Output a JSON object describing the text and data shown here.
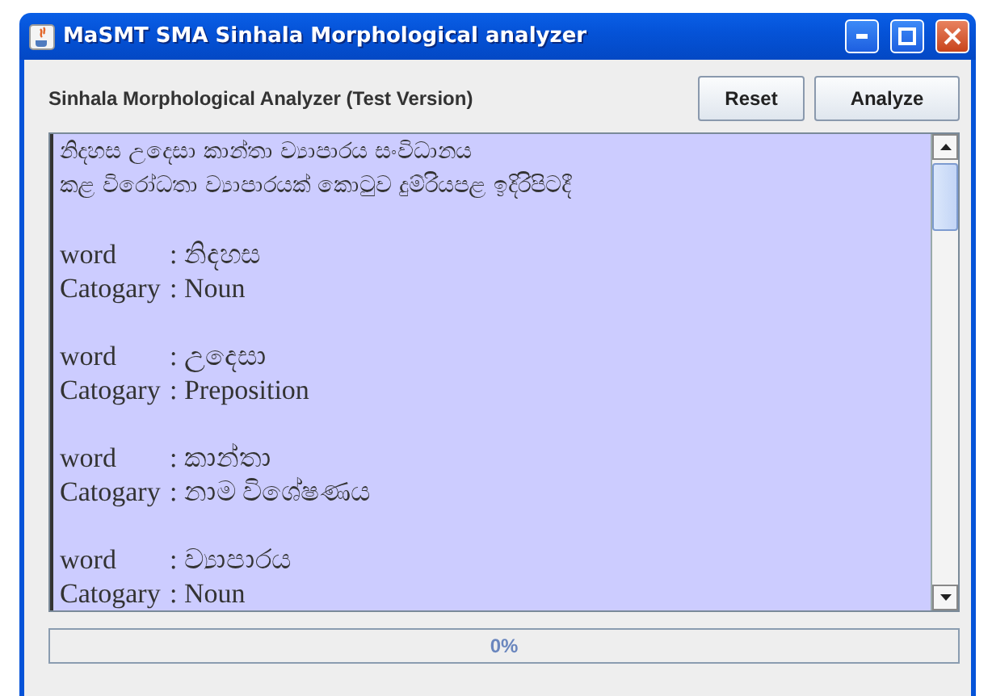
{
  "window": {
    "title": "MaSMT SMA Sinhala Morphological analyzer"
  },
  "heading": "Sinhala Morphological Analyzer (Test Version)",
  "buttons": [
    "Reset",
    "Analyze"
  ],
  "output": {
    "sentence_lines": [
      "නිදහස උදෙසා කාන්තා ව්‍යාපාරය සංවිධානය",
      "කළ විරෝධතා ව්‍යාපාරයක් කොටුව දුම්රියපළ ඉදිරිපිටදී"
    ],
    "entries": [
      {
        "word_label": "word",
        "word": ": නිදහස",
        "category_label": "Catogary",
        "category": ": Noun"
      },
      {
        "word_label": "word",
        "word": ": උදෙසා",
        "category_label": "Catogary",
        "category": ": Preposition"
      },
      {
        "word_label": "word",
        "word": ": කාන්තා",
        "category_label": "Catogary",
        "category": ": නාම විශේෂණය"
      },
      {
        "word_label": "word",
        "word": ": ව්‍යාපාරය",
        "category_label": "Catogary",
        "category": ": Noun"
      }
    ]
  },
  "progress": {
    "level": 0,
    "text": "0%"
  }
}
